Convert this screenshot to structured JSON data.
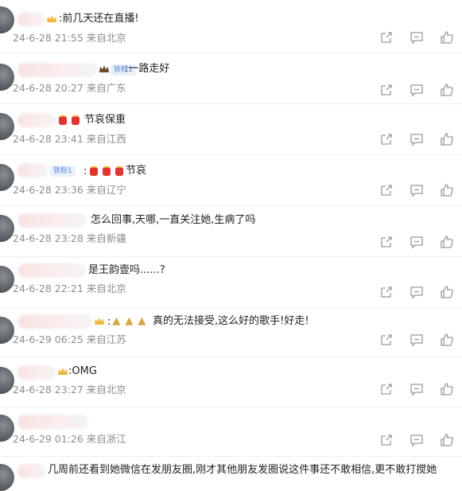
{
  "comments": [
    {
      "text": ":前几天还在直播!",
      "time": "24-6-28 21:55",
      "location": "来自北京"
    },
    {
      "badge": "铁粉1",
      "text": ":一路走好",
      "time": "24-6-28 20:27",
      "location": "来自广东"
    },
    {
      "text": "节哀保重",
      "time": "24-6-28 23:41",
      "location": "来自江西"
    },
    {
      "badge": "铁粉1",
      "text": "节哀",
      "time": "24-6-28 23:36",
      "location": "来自辽宁"
    },
    {
      "text": "怎么回事,天哪,一直关注她,生病了吗",
      "time": "24-6-28 23:28",
      "location": "来自新疆"
    },
    {
      "text": "是王韵壹吗......?",
      "time": "24-6-28 22:21",
      "location": "来自北京"
    },
    {
      "text": "真的无法接受,这么好的歌手!好走!",
      "time": "24-6-29 06:25",
      "location": "来自江苏"
    },
    {
      "text": ":OMG",
      "time": "24-6-28 23:27",
      "location": "来自北京"
    },
    {
      "text": "",
      "time": "24-6-29 01:26",
      "location": "来自浙江"
    },
    {
      "text": "几周前还看到她微信在发朋友圈,刚才其他朋友发圈说这件事还不敢相信,更不敢打搅她"
    }
  ],
  "icons": {
    "share": "share-icon",
    "comment": "comment-icon",
    "like": "thumbs-up-icon"
  },
  "colors": {
    "meta": "#8d8d8d",
    "badge": "#5b8fd6"
  }
}
